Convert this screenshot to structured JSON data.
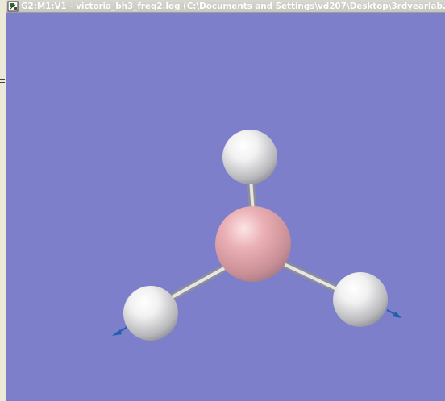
{
  "window": {
    "title": "G2:M1:V1 - victoria_bh3_freq2.log (C:\\Documents and Settings\\vd207\\Desktop\\3rdyearlab...",
    "icon": "gaussview-document-icon"
  },
  "viewport": {
    "background": "#7d7fcb"
  },
  "molecule": {
    "name": "BH3",
    "atoms": [
      {
        "element": "B",
        "color": "#e8a8ad"
      },
      {
        "element": "H",
        "color": "#f2f2f2"
      },
      {
        "element": "H",
        "color": "#f2f2f2"
      },
      {
        "element": "H",
        "color": "#f2f2f2"
      }
    ],
    "bond_color": "#c9c9c9",
    "vector_color": "#1f5fb0"
  }
}
